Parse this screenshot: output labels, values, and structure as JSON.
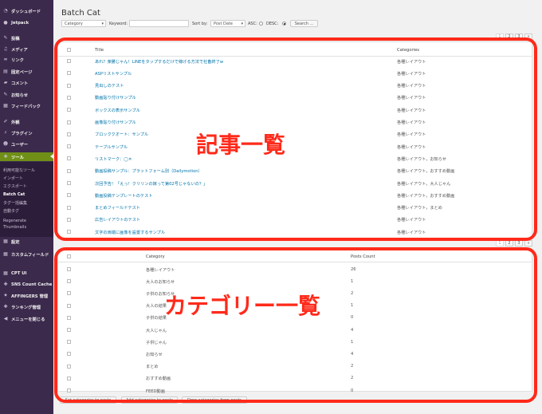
{
  "sidebar": {
    "items": [
      {
        "label": "ダッシュボード",
        "icon": "dashboard-icon",
        "glyph": "◔"
      },
      {
        "label": "Jetpack",
        "icon": "jetpack-icon",
        "glyph": "●"
      },
      {
        "label": "投稿",
        "icon": "pin-icon",
        "glyph": "✎"
      },
      {
        "label": "メディア",
        "icon": "media-icon",
        "glyph": "♫"
      },
      {
        "label": "リンク",
        "icon": "link-icon",
        "glyph": "∞"
      },
      {
        "label": "固定ページ",
        "icon": "page-icon",
        "glyph": "▤"
      },
      {
        "label": "コメント",
        "icon": "comment-icon",
        "glyph": "▰"
      },
      {
        "label": "お知らせ",
        "icon": "pin-icon",
        "glyph": "✎"
      },
      {
        "label": "フィードバック",
        "icon": "feedback-icon",
        "glyph": "▦"
      },
      {
        "label": "外観",
        "icon": "appearance-icon",
        "glyph": "✐"
      },
      {
        "label": "プラグイン",
        "icon": "plugin-icon",
        "glyph": "⚡"
      },
      {
        "label": "ユーザー",
        "icon": "user-icon",
        "glyph": "☻"
      },
      {
        "label": "ツール",
        "icon": "tools-icon",
        "glyph": "✚"
      },
      {
        "label": "設定",
        "icon": "settings-icon",
        "glyph": "▦"
      },
      {
        "label": "カスタムフィールド",
        "icon": "custom-field-icon",
        "glyph": "▦"
      },
      {
        "label": "CPT UI",
        "icon": "cpt-icon",
        "glyph": "▦"
      },
      {
        "label": "SNS Count Cache",
        "icon": "sns-icon",
        "glyph": "✚"
      },
      {
        "label": "AFFINGERS 管理",
        "icon": "gear-icon",
        "glyph": "✷"
      },
      {
        "label": "ランキング管理",
        "icon": "ranking-icon",
        "glyph": "✚"
      },
      {
        "label": "メニューを閉じる",
        "icon": "collapse-icon",
        "glyph": "◀"
      }
    ],
    "submenu": [
      "利用可能なツール",
      "インポート",
      "エクスポート",
      "Batch Cat",
      "タグ一括編集",
      "自動タグ",
      "Regenerate",
      "Thumbnails"
    ]
  },
  "page_title": "Batch Cat",
  "filters": {
    "category_select": "Category",
    "keyword_label": "Keyword:",
    "sort_label": "Sort by:",
    "sort_select": "Post Date",
    "asc_label": "ASC:",
    "desc_label": "DESC:",
    "search_button": "Search ..."
  },
  "pagination": {
    "pages": [
      "1",
      "2",
      "3",
      "»"
    ]
  },
  "posts_table": {
    "headers": {
      "title": "Title",
      "categories": "Categories"
    },
    "rows": [
      {
        "title": "あれ？楽勝じゃん！LINEをタップするだけで稼げる方法で社畜終了w",
        "categories": "各種レイアウト"
      },
      {
        "title": "ASPリストサンプル",
        "categories": "各種レイアウト"
      },
      {
        "title": "見出しのテスト",
        "categories": "各種レイアウト"
      },
      {
        "title": "動画貼り付けサンプル",
        "categories": "各種レイアウト"
      },
      {
        "title": "ボックスの表示サンプル",
        "categories": "各種レイアウト"
      },
      {
        "title": "画像貼り付けサンプル",
        "categories": "各種レイアウト"
      },
      {
        "title": "ブロッククオート：サンプル",
        "categories": "各種レイアウト"
      },
      {
        "title": "テーブルサンプル",
        "categories": "各種レイアウト"
      },
      {
        "title": "リストマーク：◯✕",
        "categories": "各種レイアウト，お知らせ"
      },
      {
        "title": "動画投稿サンプル：プラットフォーム別（Dailymotion）",
        "categories": "各種レイアウト，おすすめ動画"
      },
      {
        "title": "次回予告！「えっ！クリリンの嫁って第02号じゃないの？」",
        "categories": "各種レイアウト，大人じゃん"
      },
      {
        "title": "動画投稿テンプレートのテスト",
        "categories": "各種レイアウト，おすすめ動画"
      },
      {
        "title": "まとめフィールドテスト",
        "categories": "各種レイアウト，まとめ"
      },
      {
        "title": "広告レイアウトのテスト",
        "categories": "各種レイアウト"
      },
      {
        "title": "文字の両端に画像を設置するサンプル",
        "categories": "各種レイアウト"
      }
    ]
  },
  "categories_table": {
    "headers": {
      "category": "Category",
      "count": "Posts Count"
    },
    "rows": [
      {
        "category": "各種レイアウト",
        "count": "26"
      },
      {
        "category": "大人のお知らせ",
        "count": "1"
      },
      {
        "category": "子供のお知らせ",
        "count": "2"
      },
      {
        "category": "大人の結果",
        "count": "1"
      },
      {
        "category": "子供の結果",
        "count": "0"
      },
      {
        "category": "大人じゃん",
        "count": "4"
      },
      {
        "category": "子供じゃん",
        "count": "1"
      },
      {
        "category": "お知らせ",
        "count": "4"
      },
      {
        "category": "まとめ",
        "count": "2"
      },
      {
        "category": "おすすめ動画",
        "count": "2"
      },
      {
        "category": "FEED動画",
        "count": "0"
      }
    ]
  },
  "bottom_buttons": [
    "Set categories to posts",
    "Add categories to posts",
    "Drop categories from posts"
  ],
  "annotations": {
    "posts": "記事一覧",
    "categories": "カテゴリー一覧"
  },
  "colors": {
    "sidebar": "#3c2a4d",
    "active": "#6f8f17",
    "annotation": "#ff2a1a"
  }
}
